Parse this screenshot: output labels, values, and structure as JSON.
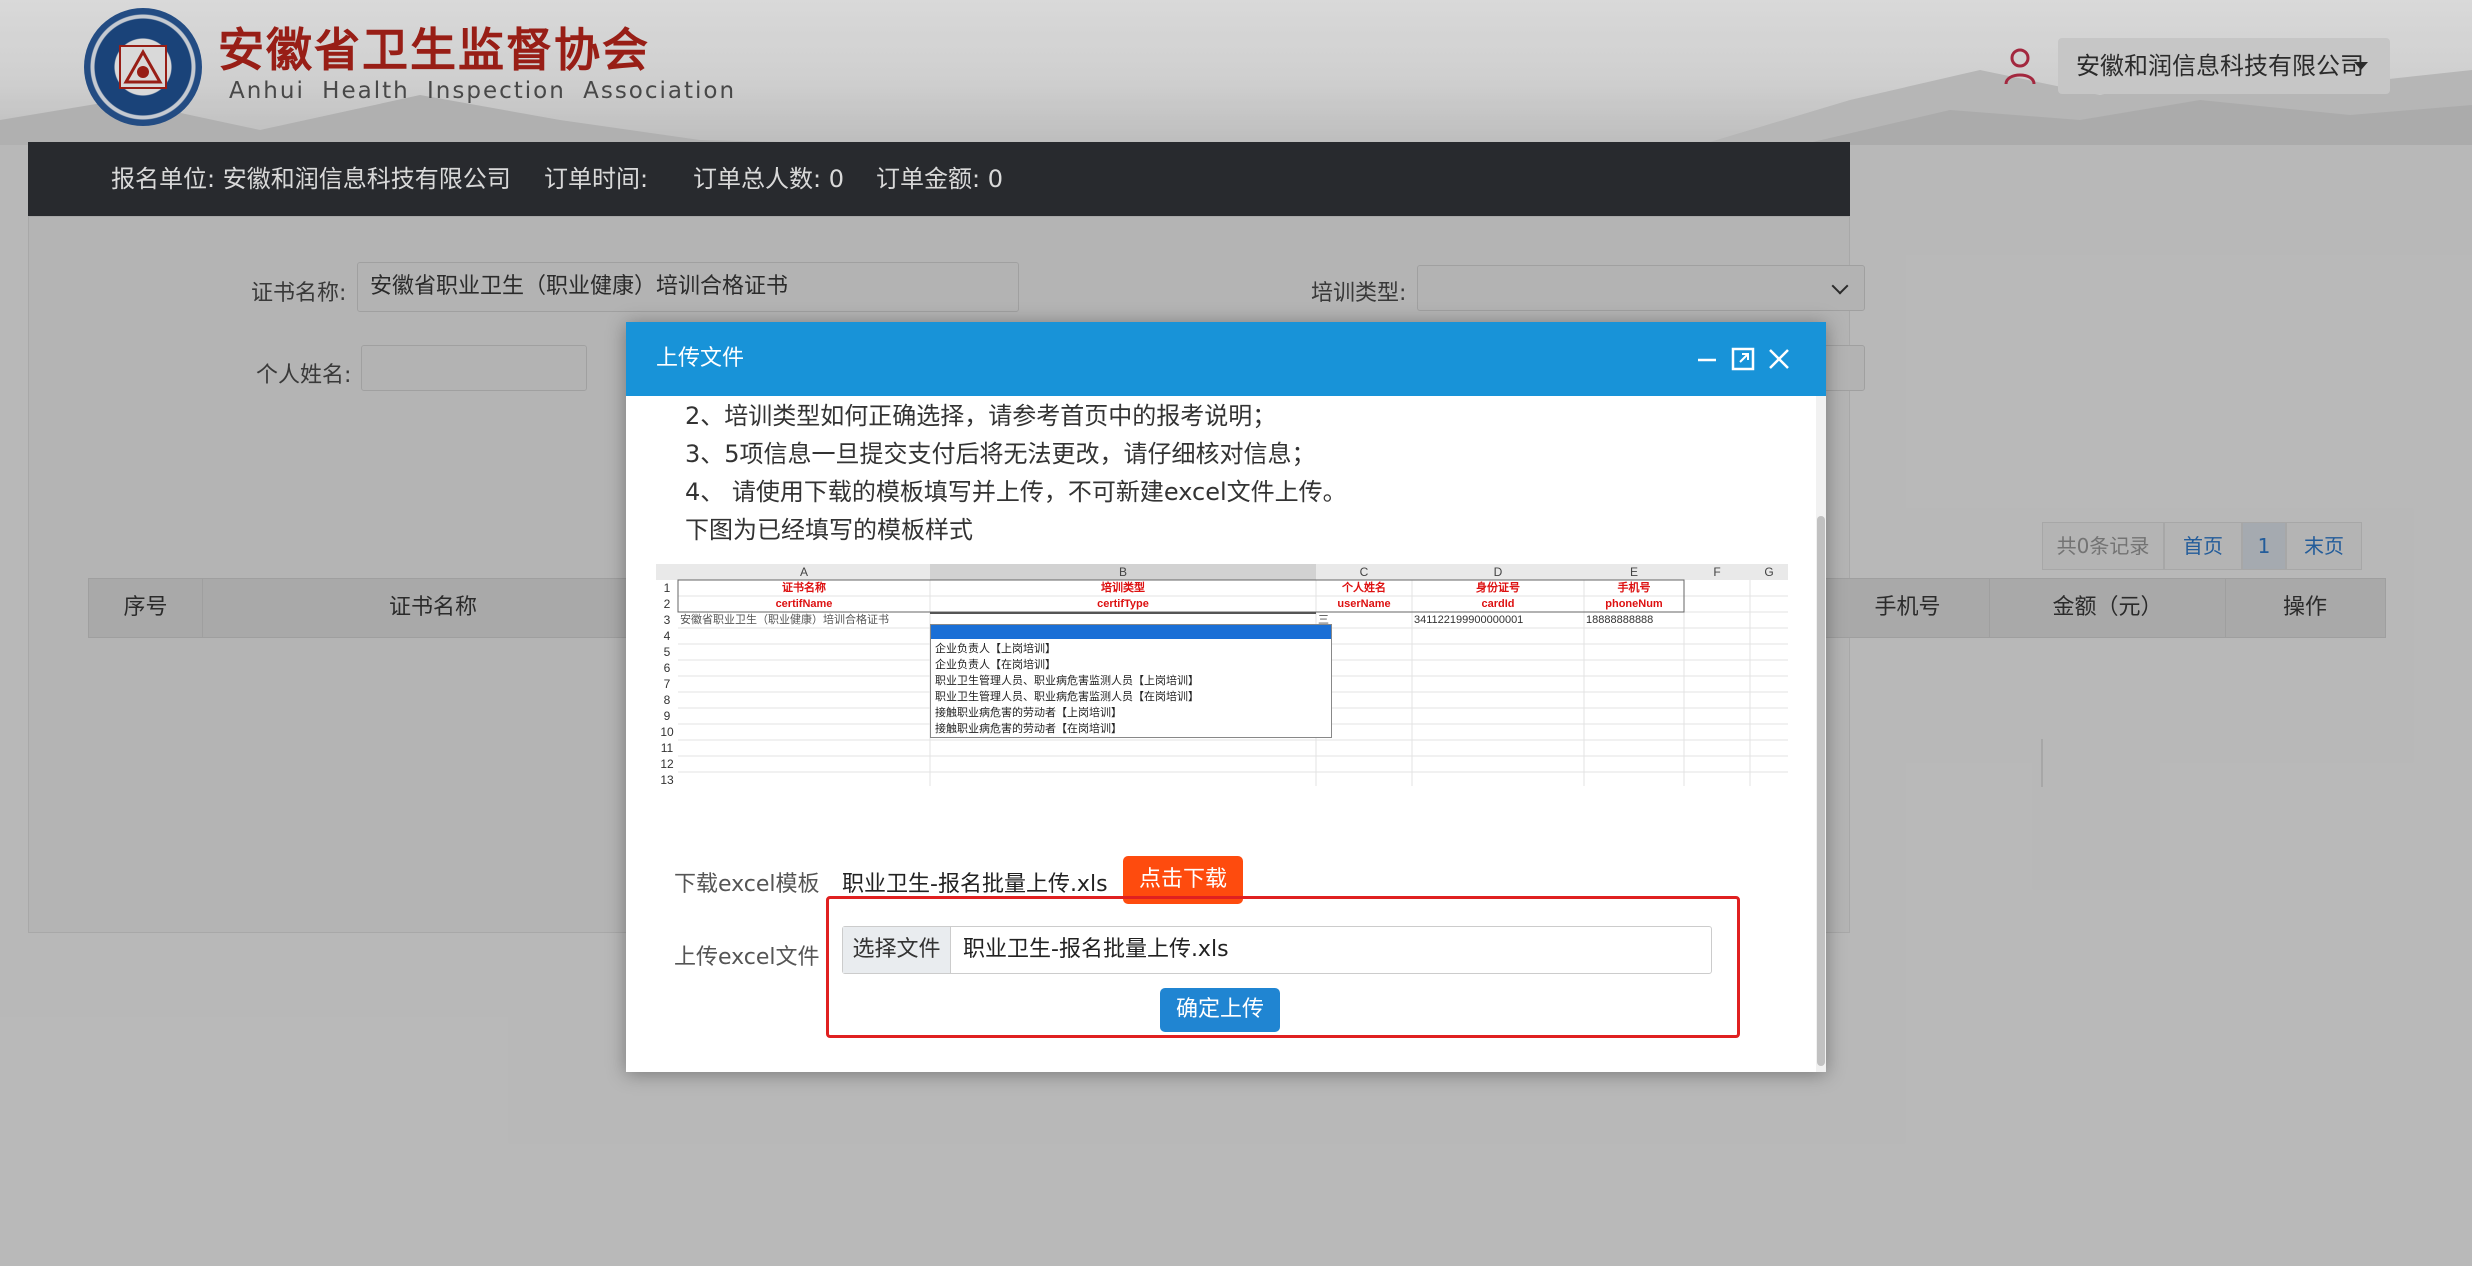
{
  "header": {
    "brand_cn": "安徽省卫生监督协会",
    "brand_en": "Anhui Health Inspection Association",
    "company_dropdown": "安徽和润信息科技有限公司"
  },
  "order_bar": {
    "unit": "报名单位: 安徽和润信息科技有限公司",
    "time": "订单时间:",
    "count": "订单总人数: 0",
    "amount": "订单金额: 0"
  },
  "form": {
    "cert_label": "证书名称:",
    "cert_value": "安徽省职业卫生（职业健康）培训合格证书",
    "train_type_label": "培训类型:",
    "name_label": "个人姓名:"
  },
  "pager": {
    "total": "共0条记录",
    "first": "首页",
    "current": "1",
    "last": "末页"
  },
  "table": {
    "headers": [
      "序号",
      "证书名称",
      "手机号",
      "金额（元）",
      "操作"
    ]
  },
  "modal": {
    "title": "上传文件",
    "instructions": [
      "2、培训类型如何正确选择，请参考首页中的报考说明；",
      "3、5项信息一旦提交支付后将无法更改，请仔细核对信息；",
      "4、 请使用下载的模板填写并上传，不可新建excel文件上传。",
      "下图为已经填写的模板样式"
    ],
    "excel": {
      "cols": [
        "A",
        "B",
        "C",
        "D",
        "E",
        "F",
        "G"
      ],
      "rows": [
        "1",
        "2",
        "3",
        "4",
        "5",
        "6",
        "7",
        "8",
        "9",
        "10",
        "11",
        "12",
        "13"
      ],
      "header_cn": [
        "证书名称",
        "培训类型",
        "个人姓名",
        "身份证号",
        "手机号"
      ],
      "header_en": [
        "certifName",
        "certifType",
        "userName",
        "cardId",
        "phoneNum"
      ],
      "row3": [
        "安徽省职业卫生（职业健康）培训合格证书",
        "",
        "三",
        "341122199900000001",
        "18888888888"
      ],
      "dropdown_items": [
        "企业负责人【上岗培训】",
        "企业负责人【在岗培训】",
        "职业卫生管理人员、职业病危害监测人员【上岗培训】",
        "职业卫生管理人员、职业病危害监测人员【在岗培训】",
        "接触职业病危害的劳动者【上岗培训】",
        "接触职业病危害的劳动者【在岗培训】"
      ]
    },
    "download_label": "下载excel模板",
    "download_file": "职业卫生-报名批量上传.xls",
    "download_button": "点击下载",
    "upload_label": "上传excel文件",
    "choose_file_button": "选择文件",
    "chosen_file": "职业卫生-报名批量上传.xls",
    "confirm_button": "确定上传"
  }
}
